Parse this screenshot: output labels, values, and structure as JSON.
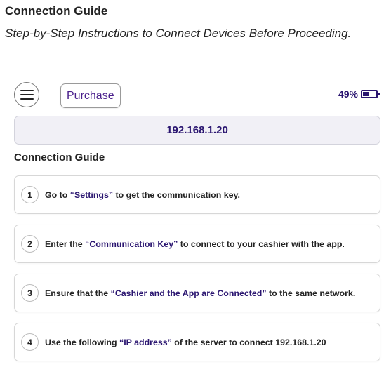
{
  "document": {
    "title": "Connection Guide",
    "subtitle": "Step-by-Step Instructions to Connect Devices Before Proceeding."
  },
  "app": {
    "menu_icon": "hamburger-menu-icon",
    "purchase_label": "Purchase",
    "battery": {
      "percent_label": "49%",
      "level": 0.49,
      "icon": "battery-icon"
    },
    "ip_address": "192.168.1.20",
    "section_title": "Connection Guide",
    "steps": [
      {
        "number": "1",
        "prefix": "Go to ",
        "highlight": "“Settings”",
        "suffix": " to get the communication key."
      },
      {
        "number": "2",
        "prefix": "Enter the ",
        "highlight": "“Communication Key”",
        "suffix": " to connect to your cashier with the app."
      },
      {
        "number": "3",
        "prefix": "Ensure that the ",
        "highlight": "“Cashier and the App are Connected”",
        "suffix": " to the same network."
      },
      {
        "number": "4",
        "prefix": "Use the following ",
        "highlight": "“IP address”",
        "suffix": " of the server to connect 192.168.1.20"
      }
    ],
    "colors": {
      "accent": "#2a1570",
      "ip_box_background": "#f1f0f6",
      "card_border": "#d7d7d7"
    }
  }
}
